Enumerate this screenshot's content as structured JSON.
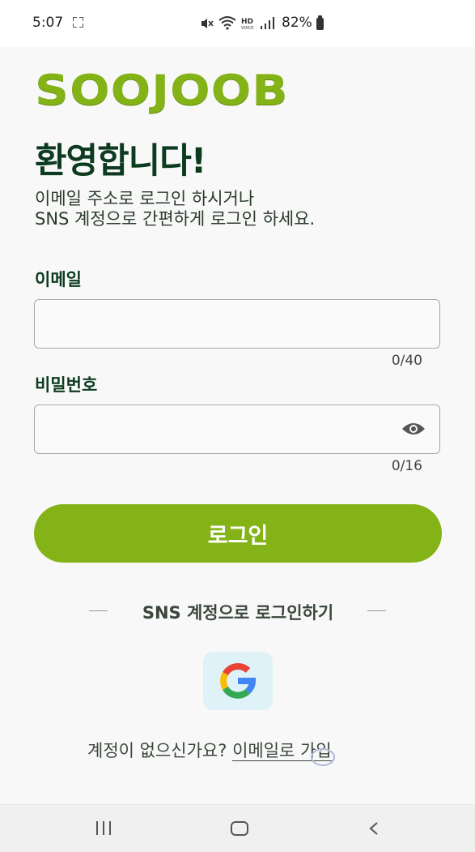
{
  "status_bar": {
    "time": "5:07",
    "battery": "82%",
    "icons": [
      "screen-capture-icon",
      "mute-icon",
      "wifi-icon",
      "hd-voice-icon",
      "signal-icon",
      "battery-icon"
    ]
  },
  "brand": {
    "logo_text": "SOOJOOB",
    "accent_color": "#84b317"
  },
  "welcome": {
    "title": "환영합니다!",
    "subtitle_line1": "이메일 주소로 로그인 하시거나",
    "subtitle_line2": "SNS 계정으로 간편하게 로그인 하세요."
  },
  "email_field": {
    "label": "이메일",
    "value": "",
    "counter": "0/40"
  },
  "password_field": {
    "label": "비밀번호",
    "value": "",
    "counter": "0/16",
    "visibility_icon": "eye-icon"
  },
  "login_button": {
    "label": "로그인"
  },
  "sns": {
    "divider_text": "SNS 계정으로 로그인하기",
    "providers": [
      "google"
    ]
  },
  "signup": {
    "prompt": "계정이 없으신가요?",
    "link_text": "이메일로 가입"
  },
  "nav_bar": {
    "icons": [
      "recent-apps-icon",
      "home-icon",
      "back-icon"
    ]
  }
}
